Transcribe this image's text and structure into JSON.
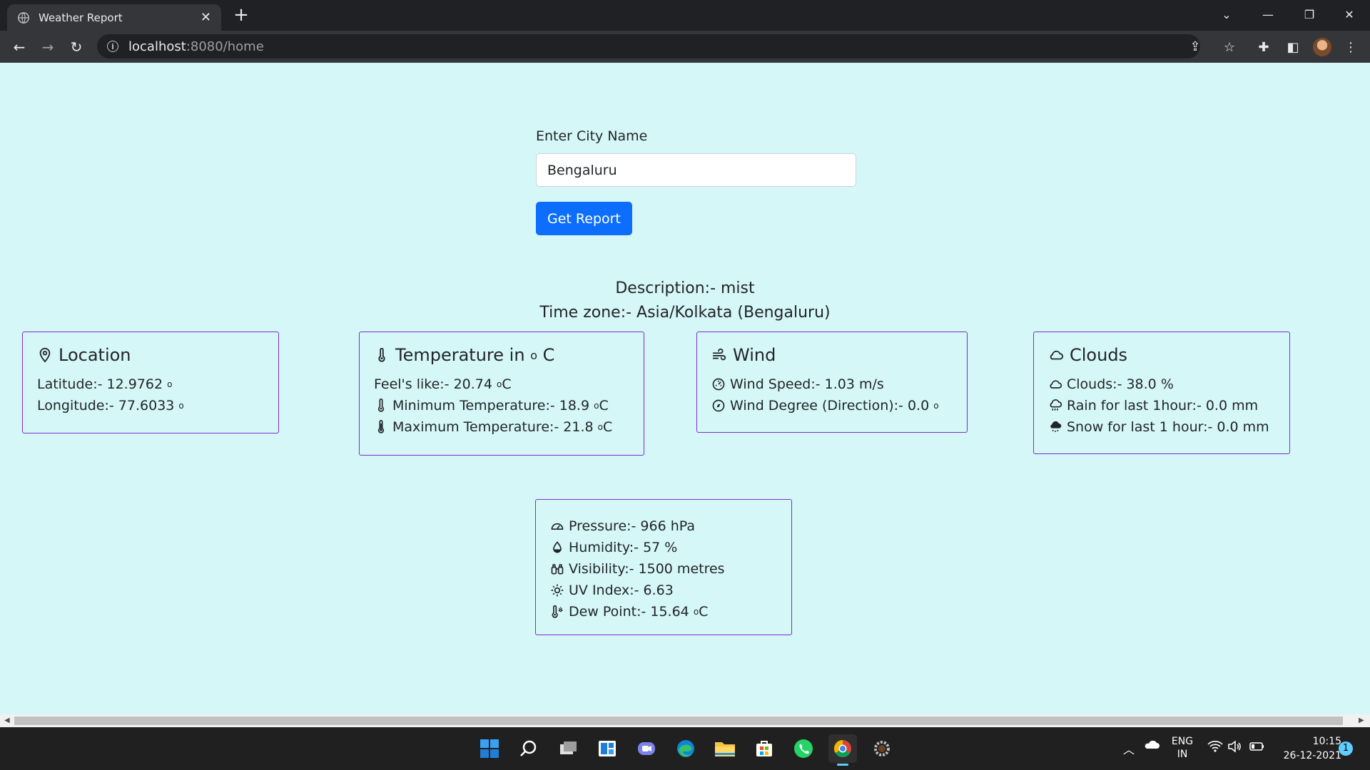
{
  "browser": {
    "tab_title": "Weather Report",
    "url_host": "localhost",
    "url_path": ":8080/home"
  },
  "form": {
    "label": "Enter City Name",
    "city_value": "Bengaluru",
    "submit_label": "Get Report"
  },
  "summary": {
    "description": "Description:- mist",
    "timezone": "Time zone:- Asia/Kolkata (Bengaluru)"
  },
  "location": {
    "title": "Location",
    "latitude": "Latitude:- 12.9762",
    "longitude": "Longitude:- 77.6033",
    "degree": "o"
  },
  "temperature": {
    "title": "Temperature in",
    "title_unit": "C",
    "feels_like": "Feel's like:- 20.74",
    "min": "Minimum Temperature:- 18.9",
    "max": "Maximum Temperature:- 21.8",
    "unit": "C",
    "degree": "o"
  },
  "wind": {
    "title": "Wind",
    "speed": "Wind Speed:- 1.03 m/s",
    "direction": "Wind Degree (Direction):- 0.0",
    "degree": "o"
  },
  "clouds": {
    "title": "Clouds",
    "clouds": "Clouds:- 38.0 %",
    "rain": "Rain for last 1hour:- 0.0 mm",
    "snow": "Snow for last 1 hour:- 0.0 mm"
  },
  "misc": {
    "pressure": "Pressure:- 966 hPa",
    "humidity": "Humidity:- 57 %",
    "visibility": "Visibility:- 1500 metres",
    "uv": "UV Index:- 6.63",
    "dew": "Dew Point:- 15.64",
    "dew_unit": "C",
    "degree": "o"
  },
  "taskbar": {
    "lang_top": "ENG",
    "lang_bottom": "IN",
    "time": "10:15",
    "date": "26-12-2021",
    "notification_count": "1"
  }
}
